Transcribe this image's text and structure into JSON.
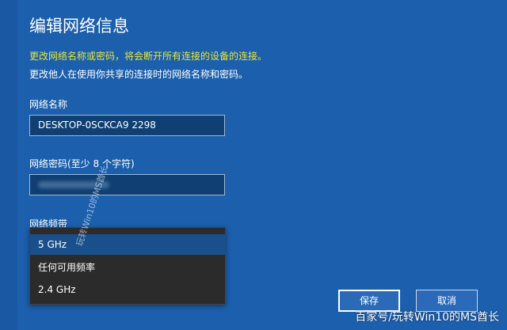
{
  "dialog": {
    "title": "编辑网络信息",
    "warning": "更改网络名称或密码，将会断开所有连接的设备的连接。",
    "info": "更改他人在使用你共享的连接时的网络名称和密码。"
  },
  "network_name": {
    "label": "网络名称",
    "value": "DESKTOP-0SCKCA9 2298"
  },
  "network_password": {
    "label": "网络密码(至少 8 个字符)"
  },
  "band": {
    "label": "网络频带",
    "options": [
      "5 GHz",
      "任何可用频率",
      "2.4 GHz"
    ],
    "selected_index": 0
  },
  "buttons": {
    "save": "保存",
    "cancel": "取消"
  },
  "watermarks": {
    "diagonal": "玩转Win10的MS酋长",
    "corner": "百家号/玩转Win10的MS酋长"
  },
  "colors": {
    "background": "#1b5fad",
    "warning_text": "#e6e63c",
    "input_bg": "#0f3f73",
    "dropdown_bg": "#2b2b2b",
    "selected_option": "#194f8b"
  }
}
